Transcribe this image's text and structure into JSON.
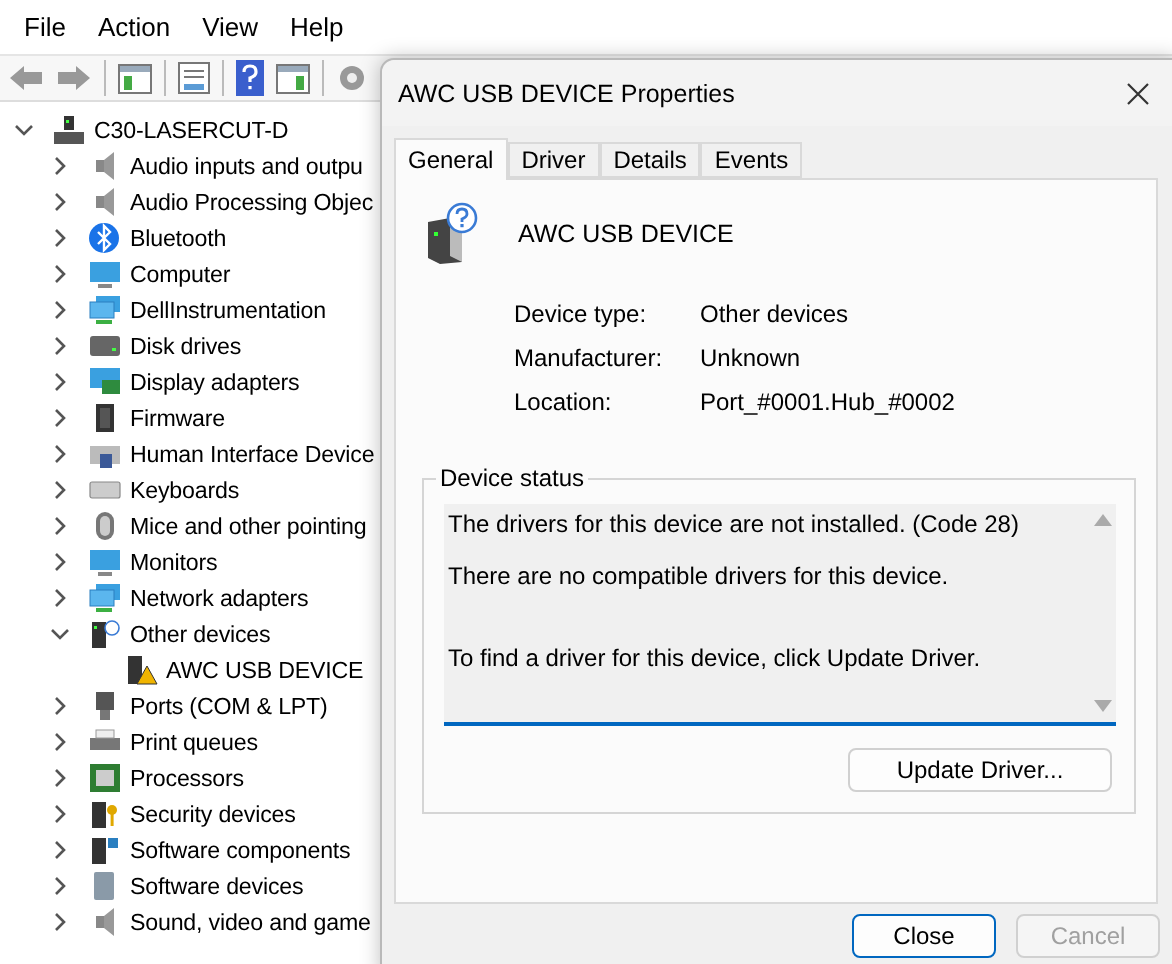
{
  "menu": [
    "File",
    "Action",
    "View",
    "Help"
  ],
  "tree": {
    "label": "C30-LASERCUT-D",
    "expanded": true,
    "children": [
      {
        "label": "Audio inputs and outpu",
        "expanded": false
      },
      {
        "label": "Audio Processing Objec",
        "expanded": false
      },
      {
        "label": "Bluetooth",
        "expanded": false
      },
      {
        "label": "Computer",
        "expanded": false
      },
      {
        "label": "DellInstrumentation",
        "expanded": false
      },
      {
        "label": "Disk drives",
        "expanded": false
      },
      {
        "label": "Display adapters",
        "expanded": false
      },
      {
        "label": "Firmware",
        "expanded": false
      },
      {
        "label": "Human Interface Device",
        "expanded": false
      },
      {
        "label": "Keyboards",
        "expanded": false
      },
      {
        "label": "Mice and other pointing",
        "expanded": false
      },
      {
        "label": "Monitors",
        "expanded": false
      },
      {
        "label": "Network adapters",
        "expanded": false
      },
      {
        "label": "Other devices",
        "expanded": true,
        "children": [
          {
            "label": "AWC USB DEVICE"
          }
        ]
      },
      {
        "label": "Ports (COM & LPT)",
        "expanded": false
      },
      {
        "label": "Print queues",
        "expanded": false
      },
      {
        "label": "Processors",
        "expanded": false
      },
      {
        "label": "Security devices",
        "expanded": false
      },
      {
        "label": "Software components",
        "expanded": false
      },
      {
        "label": "Software devices",
        "expanded": false
      },
      {
        "label": "Sound, video and game",
        "expanded": false
      }
    ]
  },
  "dialog": {
    "title": "AWC USB DEVICE Properties",
    "tabs": [
      {
        "label": "General",
        "selected": true
      },
      {
        "label": "Driver",
        "selected": false
      },
      {
        "label": "Details",
        "selected": false
      },
      {
        "label": "Events",
        "selected": false
      }
    ],
    "device_name": "AWC USB DEVICE",
    "properties": [
      {
        "label": "Device type:",
        "value": "Other devices"
      },
      {
        "label": "Manufacturer:",
        "value": "Unknown"
      },
      {
        "label": "Location:",
        "value": "Port_#0001.Hub_#0002"
      }
    ],
    "status_label": "Device status",
    "status_lines": [
      "The drivers for this device are not installed. (Code 28)",
      "There are no compatible drivers for this device.",
      "To find a driver for this device, click Update Driver."
    ],
    "update_button": "Update Driver...",
    "buttons": [
      {
        "label": "Close",
        "default": true,
        "disabled": false
      },
      {
        "label": "Cancel",
        "default": false,
        "disabled": true
      }
    ]
  }
}
